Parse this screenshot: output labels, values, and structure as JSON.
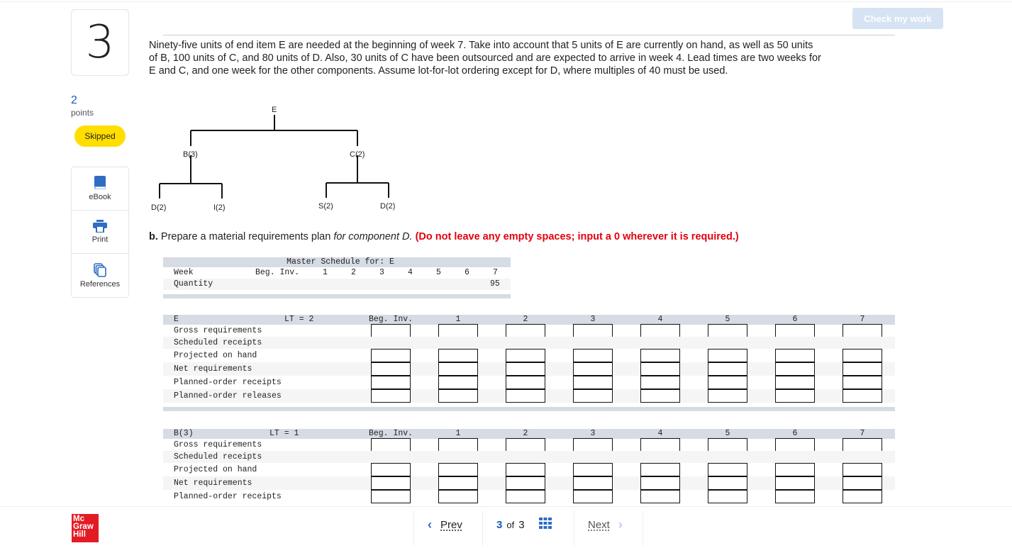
{
  "question": {
    "number": "3",
    "points_value": "2",
    "points_label": "points",
    "status": "Skipped",
    "check_button": "Check my work",
    "problem_text": "Ninety-five units of end item E are needed at the beginning of week 7. Take into account that 5 units of E are currently on hand, as well as 50 units of B, 100 units of C, and 80 units of D. Also, 30 units of C have been outsourced and are expected to arrive in week 4. Lead times are two weeks for E and C, and one week for the other components. Assume lot-for-lot ordering except for D, where multiples of 40 must be used."
  },
  "tools": [
    {
      "label": "eBook",
      "icon": "book-icon"
    },
    {
      "label": "Print",
      "icon": "printer-icon"
    },
    {
      "label": "References",
      "icon": "copy-icon"
    }
  ],
  "tree": {
    "root": "E",
    "level1": [
      "B(3)",
      "C(2)"
    ],
    "level2_b": [
      "D(2)",
      "I(2)"
    ],
    "level2_c": [
      "S(2)",
      "D(2)"
    ]
  },
  "part_b": {
    "prefix": "b.",
    "text": " Prepare a material requirements plan ",
    "italic": "for component D.",
    "instruction": "(Do not leave any empty spaces; input a 0 wherever it is required.)"
  },
  "master_schedule": {
    "title": "Master Schedule for: E",
    "week_label": "Week",
    "beg_inv_label": "Beg. Inv.",
    "weeks": [
      "1",
      "2",
      "3",
      "4",
      "5",
      "6",
      "7"
    ],
    "quantity_label": "Quantity",
    "quantities": [
      "",
      "",
      "",
      "",
      "",
      "",
      "95"
    ]
  },
  "mrp_tables": [
    {
      "item": "E",
      "lt": "LT = 2",
      "beg_inv_label": "Beg. Inv.",
      "weeks": [
        "1",
        "2",
        "3",
        "4",
        "5",
        "6",
        "7"
      ],
      "rows": [
        {
          "label": "Gross requirements",
          "has_beg": true,
          "values": [
            "",
            "",
            "",
            "",
            "",
            "",
            "",
            ""
          ]
        },
        {
          "label": "Scheduled receipts",
          "has_beg": false,
          "values": []
        },
        {
          "label": "Projected on hand",
          "has_beg": true,
          "values": [
            "",
            "",
            "",
            "",
            "",
            "",
            "",
            ""
          ]
        },
        {
          "label": "Net requirements",
          "has_beg": true,
          "values": [
            "",
            "",
            "",
            "",
            "",
            "",
            "",
            ""
          ]
        },
        {
          "label": "Planned-order receipts",
          "has_beg": true,
          "values": [
            "",
            "",
            "",
            "",
            "",
            "",
            "",
            ""
          ]
        },
        {
          "label": "Planned-order releases",
          "has_beg": true,
          "values": [
            "",
            "",
            "",
            "",
            "",
            "",
            "",
            ""
          ]
        }
      ]
    },
    {
      "item": "B(3)",
      "lt": "LT = 1",
      "beg_inv_label": "Beg. Inv.",
      "weeks": [
        "1",
        "2",
        "3",
        "4",
        "5",
        "6",
        "7"
      ],
      "rows": [
        {
          "label": "Gross requirements",
          "has_beg": true,
          "values": [
            "",
            "",
            "",
            "",
            "",
            "",
            "",
            ""
          ]
        },
        {
          "label": "Scheduled receipts",
          "has_beg": false,
          "values": []
        },
        {
          "label": "Projected on hand",
          "has_beg": true,
          "values": [
            "",
            "",
            "",
            "",
            "",
            "",
            "",
            ""
          ]
        },
        {
          "label": "Net requirements",
          "has_beg": true,
          "values": [
            "",
            "",
            "",
            "",
            "",
            "",
            "",
            ""
          ]
        },
        {
          "label": "Planned-order receipts",
          "has_beg": true,
          "values": [
            "",
            "",
            "",
            "",
            "",
            "",
            "",
            ""
          ]
        }
      ]
    }
  ],
  "footer": {
    "logo": [
      "Mc",
      "Graw",
      "Hill"
    ],
    "prev_label": "Prev",
    "current_page": "3",
    "of_label": "of",
    "total_pages": "3",
    "next_label": "Next"
  },
  "colors": {
    "accent": "#1b5ab4",
    "skipped_badge": "#ffde00",
    "instruction_red": "#e3000f",
    "check_button_bg": "#d6e3f3",
    "logo_red": "#e31c24"
  }
}
